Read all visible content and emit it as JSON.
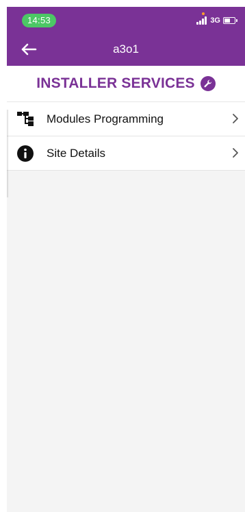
{
  "status_bar": {
    "time": "14:53",
    "network": "3G"
  },
  "nav": {
    "title": "a3o1",
    "back_icon": "arrow-left-icon"
  },
  "section": {
    "title": "INSTALLER SERVICES",
    "icon": "wrench-icon"
  },
  "menu": {
    "items": [
      {
        "label": "Modules Programming",
        "icon": "hierarchy-icon"
      },
      {
        "label": "Site Details",
        "icon": "info-icon"
      }
    ]
  },
  "colors": {
    "brand_purple": "#7a3296",
    "time_pill": "#4cc765",
    "background": "#f4f4f4"
  }
}
